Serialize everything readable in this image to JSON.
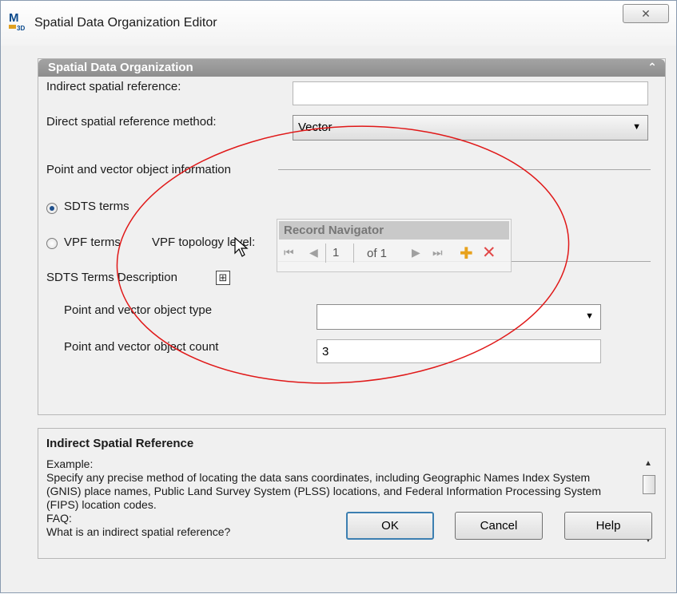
{
  "window": {
    "title": "Spatial Data Organization Editor",
    "app_icon_letter": "M",
    "app_icon_sub": "3D",
    "close_glyph": "✕"
  },
  "group": {
    "header": "Spatial Data Organization",
    "indirect_label": "Indirect spatial reference:",
    "indirect_value": "",
    "direct_label": "Direct spatial reference method:",
    "direct_value": "Vector",
    "point_vector_section": "Point and vector object information",
    "sdts_terms_label": "SDTS terms",
    "vpf_terms_label": "VPF terms",
    "vpf_topology_label": "VPF topology level:",
    "sdts_description_label": "SDTS Terms Description",
    "object_type_label": "Point and vector object type",
    "object_type_value": "",
    "object_count_label": "Point and vector object count",
    "object_count_value": "3",
    "selected_radio": "SDTS terms"
  },
  "record_navigator": {
    "title": "Record Navigator",
    "current": "1",
    "of_text": "of 1"
  },
  "help": {
    "title": "Indirect Spatial Reference",
    "lines": [
      "Example:",
      "Specify any precise method of locating the data sans coordinates, including Geographic Names Index System (GNIS) place names, Public Land Survey System (PLSS) locations, and Federal Information Processing System (FIPS) location codes.",
      "FAQ:",
      "What is an indirect spatial reference?"
    ]
  },
  "buttons": {
    "ok": "OK",
    "cancel": "Cancel",
    "help": "Help"
  },
  "colors": {
    "annotation_ellipse": "#e01818",
    "group_header": "#999999",
    "default_button_border": "#3c7fb1"
  }
}
